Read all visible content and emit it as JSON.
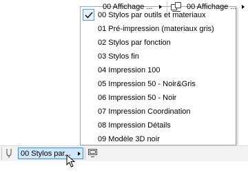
{
  "menu": {
    "items": [
      {
        "label": "00 Stylos par outils et materiaux",
        "checked": true
      },
      {
        "label": "01 Pré-impression (materiaux gris)",
        "checked": false
      },
      {
        "label": "02 Stylos par fonction",
        "checked": false
      },
      {
        "label": "03 Stylos fin",
        "checked": false
      },
      {
        "label": "04 Impression 100",
        "checked": false
      },
      {
        "label": "05 Impression 50 - Noir&Gris",
        "checked": false
      },
      {
        "label": "06 Impression 50 - Noir",
        "checked": false
      },
      {
        "label": "07 Impression Coordination",
        "checked": false
      },
      {
        "label": "08 Impression Détails",
        "checked": false
      },
      {
        "label": "09 Modèle 3D noir",
        "checked": false
      }
    ]
  },
  "toolbar": {
    "pen_set": "00 Stylos par...",
    "model_view": "00 Affichage ...",
    "dimensions": "00 Affichage ..."
  },
  "colors": {
    "accent": "#3c8fdc",
    "active_bg": "#cfe6fb",
    "toolbar_bg": "#f2f2f2"
  }
}
